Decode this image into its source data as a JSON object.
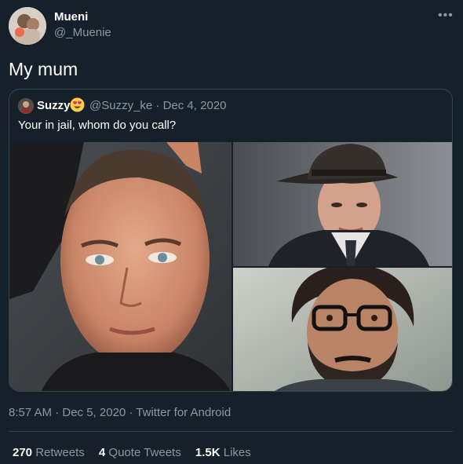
{
  "tweet": {
    "author_name": "Mueni",
    "author_handle": "@_Muenie",
    "text": "My mum"
  },
  "quoted": {
    "name": "Suzzy",
    "handle_date": "@Suzzy_ke · Dec 4, 2020",
    "text": "Your in jail, whom do you call?",
    "photos": [
      "man-with-buzzcut",
      "man-in-fedora",
      "man-with-glasses-and-beard"
    ]
  },
  "meta": {
    "timestamp": "8:57 AM · Dec 5, 2020 · Twitter for Android"
  },
  "stats": {
    "retweets_count": "270",
    "retweets_label": "Retweets",
    "quotes_count": "4",
    "quotes_label": "Quote Tweets",
    "likes_count": "1.5K",
    "likes_label": "Likes"
  },
  "colors": {
    "background": "#15202b",
    "border": "#38444d",
    "secondary_text": "#8899a6"
  }
}
